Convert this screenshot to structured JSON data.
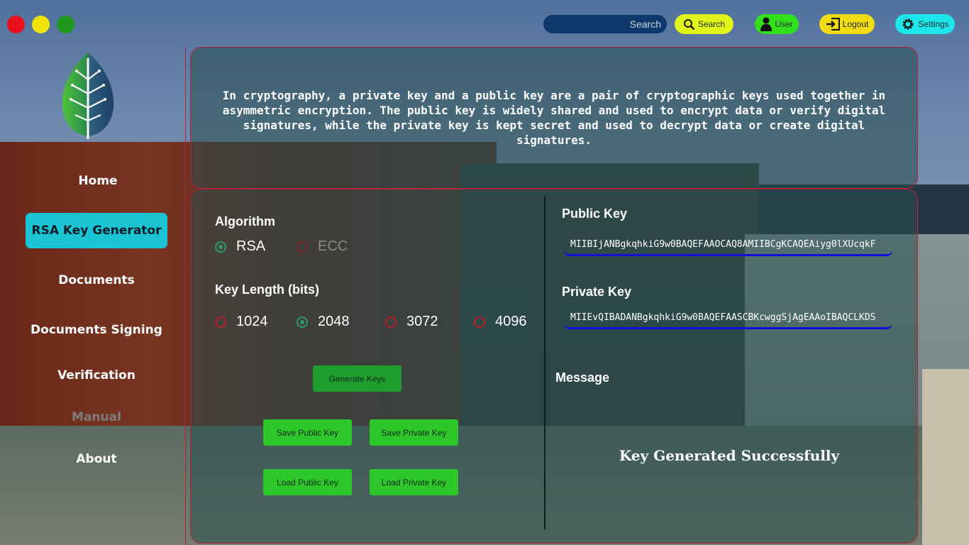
{
  "colors": {
    "close": "#e8101a",
    "minimize": "#f0e40c",
    "maximize": "#1f9a1f",
    "search_button": "#dff51a",
    "user_button": "#32e01c",
    "logout_button": "#f2dc14",
    "settings_button": "#1de6ea",
    "active_nav": "#1ac4d2",
    "action_button": "#2ec72a",
    "panel_border": "#b0243a",
    "key_underline": "#1010d8"
  },
  "topbar": {
    "search_placeholder": "Search",
    "search_button": {
      "label": "Search",
      "icon": "search-icon"
    },
    "user_button": {
      "label": "User",
      "icon": "user-icon"
    },
    "logout_button": {
      "label": "Logout",
      "icon": "logout-icon"
    },
    "settings_button": {
      "label": "Settings",
      "icon": "gear-icon"
    }
  },
  "sidebar": {
    "logo": "leaf-circuit-logo",
    "items": [
      {
        "label": "Home",
        "state": "normal"
      },
      {
        "label": "RSA Key Generator",
        "state": "active"
      },
      {
        "label": "Documents",
        "state": "normal"
      },
      {
        "label": "Documents Signing",
        "state": "normal"
      },
      {
        "label": "Verification",
        "state": "normal"
      },
      {
        "label": "Manual",
        "state": "disabled"
      },
      {
        "label": "About",
        "state": "normal"
      }
    ]
  },
  "intro": {
    "text": "In cryptography, a private key and a public key are a pair of cryptographic keys used together in asymmetric encryption. The public key is widely shared and used to encrypt data or verify digital signatures, while the private key is kept secret and used to decrypt data or create digital signatures."
  },
  "generator": {
    "algorithm_label": "Algorithm",
    "algorithms": [
      {
        "label": "RSA",
        "selected": true,
        "enabled": true
      },
      {
        "label": "ECC",
        "selected": false,
        "enabled": false
      }
    ],
    "key_length_label": "Key Length (bits)",
    "key_lengths": [
      {
        "label": "1024",
        "selected": false
      },
      {
        "label": "2048",
        "selected": true
      },
      {
        "label": "3072",
        "selected": false
      },
      {
        "label": "4096",
        "selected": false
      }
    ],
    "generate_button": "Generate Keys",
    "save_public_button": "Save Public Key",
    "save_private_button": "Save Private Key",
    "load_public_button": "Load Public Key",
    "load_private_button": "Load Private Key"
  },
  "keys": {
    "public_label": "Public Key",
    "public_value": "MIIBIjANBgkqhkiG9w0BAQEFAAOCAQ8AMIIBCgKCAQEAiyg0lXUcqkF",
    "private_label": "Private Key",
    "private_value": "MIIEvQIBADANBgkqhkiG9w0BAQEFAASCBKcwggSjAgEAAoIBAQCLKDS",
    "message_label": "Message",
    "message_text": "Key Generated Successfully"
  }
}
